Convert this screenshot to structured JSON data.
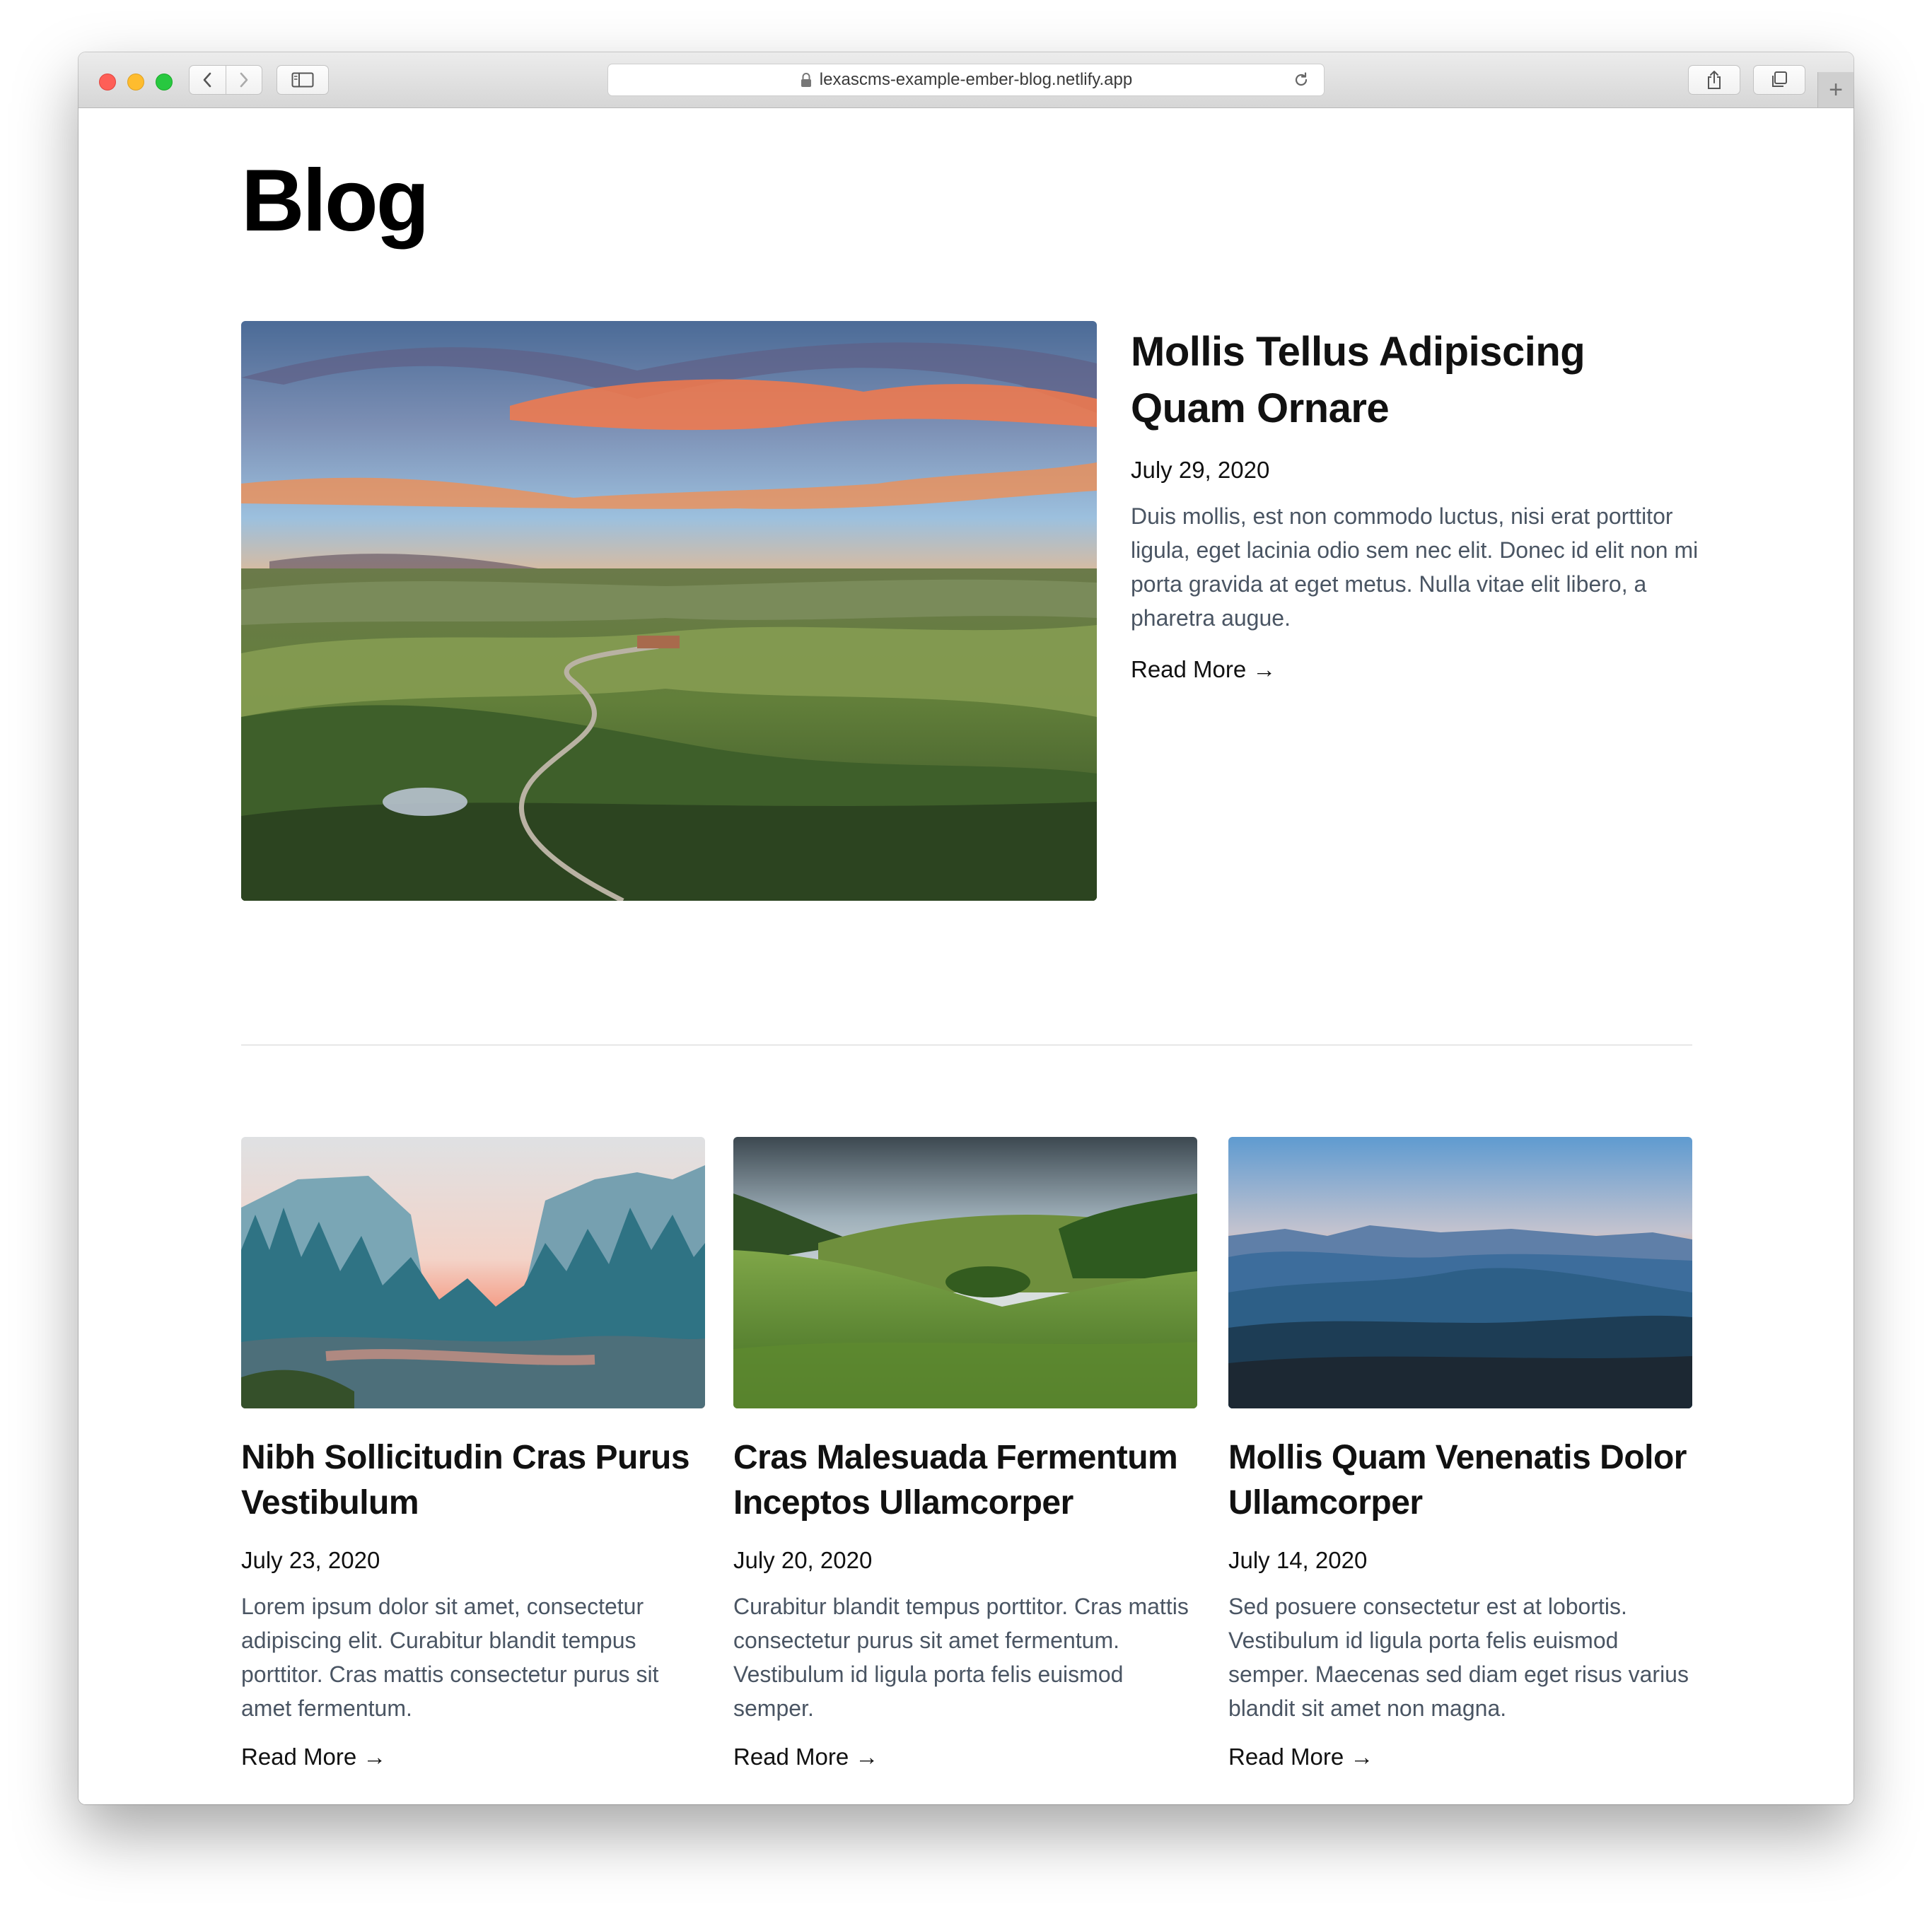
{
  "browser": {
    "url": "lexascms-example-ember-blog.netlify.app",
    "new_tab_label": "+"
  },
  "page": {
    "title": "Blog"
  },
  "featured_post": {
    "title": "Mollis Tellus Adipiscing Quam Ornare",
    "date": "July 29, 2020",
    "excerpt": "Duis mollis, est non commodo luctus, nisi erat porttitor ligula, eget lacinia odio sem nec elit. Donec id elit non mi porta gravida at eget metus. Nulla vitae elit libero, a pharetra augue.",
    "read_more": "Read More →"
  },
  "posts": [
    {
      "title": "Nibh Sollicitudin Cras Purus Vestibulum",
      "date": "July 23, 2020",
      "excerpt": "Lorem ipsum dolor sit amet, consectetur adipiscing elit. Curabitur blandit tempus porttitor. Cras mattis consectetur purus sit amet fermentum.",
      "read_more": "Read More →"
    },
    {
      "title": "Cras Malesuada Fermentum Inceptos Ullamcorper",
      "date": "July 20, 2020",
      "excerpt": "Curabitur blandit tempus porttitor. Cras mattis consectetur purus sit amet fermentum. Vestibulum id ligula porta felis euismod semper.",
      "read_more": "Read More →"
    },
    {
      "title": "Mollis Quam Venenatis Dolor Ullamcorper",
      "date": "July 14, 2020",
      "excerpt": "Sed posuere consectetur est at lobortis. Vestibulum id ligula porta felis euismod semper. Maecenas sed diam eget risus varius blandit sit amet non magna.",
      "read_more": "Read More →"
    }
  ],
  "colors": {
    "traffic_red": "#fe5f57",
    "traffic_yellow": "#febc2e",
    "traffic_green": "#28c840",
    "excerpt_text": "#4a5563"
  }
}
